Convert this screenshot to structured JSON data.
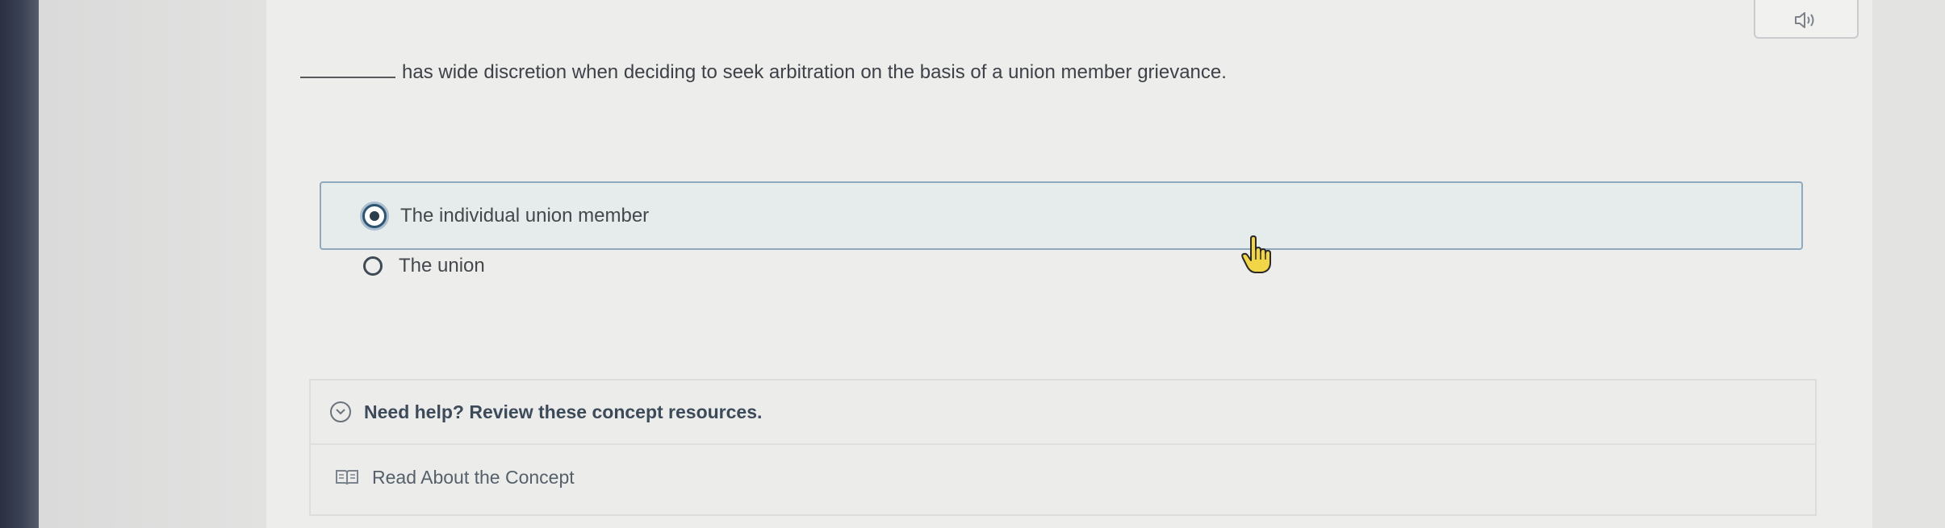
{
  "question": {
    "blank": "",
    "text": "has wide discretion when deciding to seek arbitration on the basis of a union member grievance."
  },
  "options": [
    {
      "label": "The individual union member",
      "selected": true
    },
    {
      "label": "The union",
      "selected": false
    }
  ],
  "help": {
    "title": "Need help? Review these concept resources.",
    "link_label": "Read About the Concept"
  },
  "icons": {
    "audio": "speaker-icon",
    "chevron": "chevron-down-icon",
    "book": "book-icon",
    "cursor": "hand-pointer-icon"
  },
  "colors": {
    "selected_border": "#8ea9bd",
    "selected_background": "#e5eceb",
    "heading_text": "#3c4a59"
  }
}
